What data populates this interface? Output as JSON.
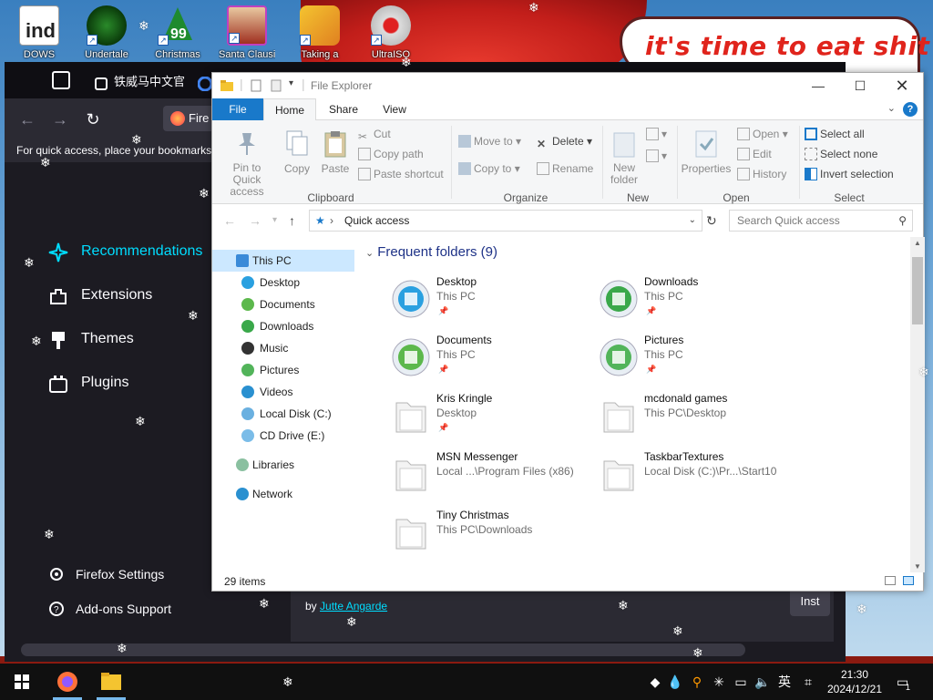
{
  "desktop": {
    "banner_text": "it's time to eat shit",
    "icons": [
      {
        "label": "DOWS"
      },
      {
        "label": "Undertale"
      },
      {
        "label": "Christmas"
      },
      {
        "label": "Santa Clausin"
      },
      {
        "label": "Taking a"
      },
      {
        "label": "UltraISO"
      }
    ],
    "icon_overlay_text": "99",
    "partial_icon_text": "ind"
  },
  "firefox": {
    "tabs": [
      {
        "label": "铁威马中文官"
      },
      {
        "label": "Fire"
      }
    ],
    "bookmarks_hint": "For quick access, place your bookmarks h",
    "sidebar": [
      {
        "label": "Recommendations",
        "active": true
      },
      {
        "label": "Extensions"
      },
      {
        "label": "Themes"
      },
      {
        "label": "Plugins"
      }
    ],
    "footer": [
      {
        "label": "Firefox Settings"
      },
      {
        "label": "Add-ons Support"
      }
    ],
    "card": {
      "byline_prefix": "by ",
      "author": "Jutte Angarde",
      "install_label": "Inst"
    }
  },
  "explorer": {
    "title": "File Explorer",
    "tabs": {
      "file": "File",
      "home": "Home",
      "share": "Share",
      "view": "View"
    },
    "ribbon": {
      "clipboard": {
        "pin": "Pin to Quick access",
        "copy": "Copy",
        "paste": "Paste",
        "cut": "Cut",
        "copy_path": "Copy path",
        "paste_shortcut": "Paste shortcut",
        "group": "Clipboard"
      },
      "organize": {
        "move_to": "Move to",
        "copy_to": "Copy to",
        "delete": "Delete",
        "rename": "Rename",
        "group": "Organize"
      },
      "new": {
        "new_folder": "New folder",
        "group": "New"
      },
      "open": {
        "properties": "Properties",
        "open": "Open",
        "edit": "Edit",
        "history": "History",
        "group": "Open"
      },
      "select": {
        "select_all": "Select all",
        "select_none": "Select none",
        "invert": "Invert selection",
        "group": "Select"
      }
    },
    "address": {
      "path": "Quick access",
      "search_placeholder": "Search Quick access"
    },
    "nav_pane": [
      {
        "label": "This PC",
        "selected": true
      },
      {
        "label": "Desktop"
      },
      {
        "label": "Documents"
      },
      {
        "label": "Downloads"
      },
      {
        "label": "Music"
      },
      {
        "label": "Pictures"
      },
      {
        "label": "Videos"
      },
      {
        "label": "Local Disk (C:)"
      },
      {
        "label": "CD Drive (E:)"
      },
      {
        "label": "Libraries"
      },
      {
        "label": "Network"
      }
    ],
    "group_header": "Frequent folders (9)",
    "folders": [
      {
        "name": "Desktop",
        "path": "This PC",
        "pinned": true,
        "icon": "desktop-icon",
        "color": "#2aa0e0"
      },
      {
        "name": "Downloads",
        "path": "This PC",
        "pinned": true,
        "icon": "downloads-icon",
        "color": "#3aa84a"
      },
      {
        "name": "Documents",
        "path": "This PC",
        "pinned": true,
        "icon": "documents-icon",
        "color": "#5cb84c"
      },
      {
        "name": "Pictures",
        "path": "This PC",
        "pinned": true,
        "icon": "pictures-icon",
        "color": "#52b45a"
      },
      {
        "name": "Kris Kringle",
        "path": "Desktop",
        "pinned": true,
        "icon": "folder-icon",
        "color": "#e8e8e8"
      },
      {
        "name": "mcdonald games",
        "path": "This PC\\Desktop",
        "pinned": false,
        "icon": "folder-icon",
        "color": "#e8e8e8"
      },
      {
        "name": "MSN Messenger",
        "path": "Local ...\\Program Files (x86)",
        "pinned": false,
        "icon": "folder-icon",
        "color": "#e8e8e8"
      },
      {
        "name": "TaskbarTextures",
        "path": "Local Disk (C:)\\Pr...\\Start10",
        "pinned": false,
        "icon": "folder-icon",
        "color": "#e8e8e8"
      },
      {
        "name": "Tiny Christmas",
        "path": "This PC\\Downloads",
        "pinned": false,
        "icon": "folder-icon",
        "color": "#e8e8e8"
      }
    ],
    "status": "29 items"
  },
  "taskbar": {
    "ime": "英",
    "time": "21:30",
    "date": "2024/12/21",
    "notification_count": "1"
  },
  "colors": {
    "accent": "#1979ca",
    "firefox_dark": "#1c1b22",
    "firefox_accent": "#00ddff",
    "desktop_red": "#c21e1a"
  }
}
